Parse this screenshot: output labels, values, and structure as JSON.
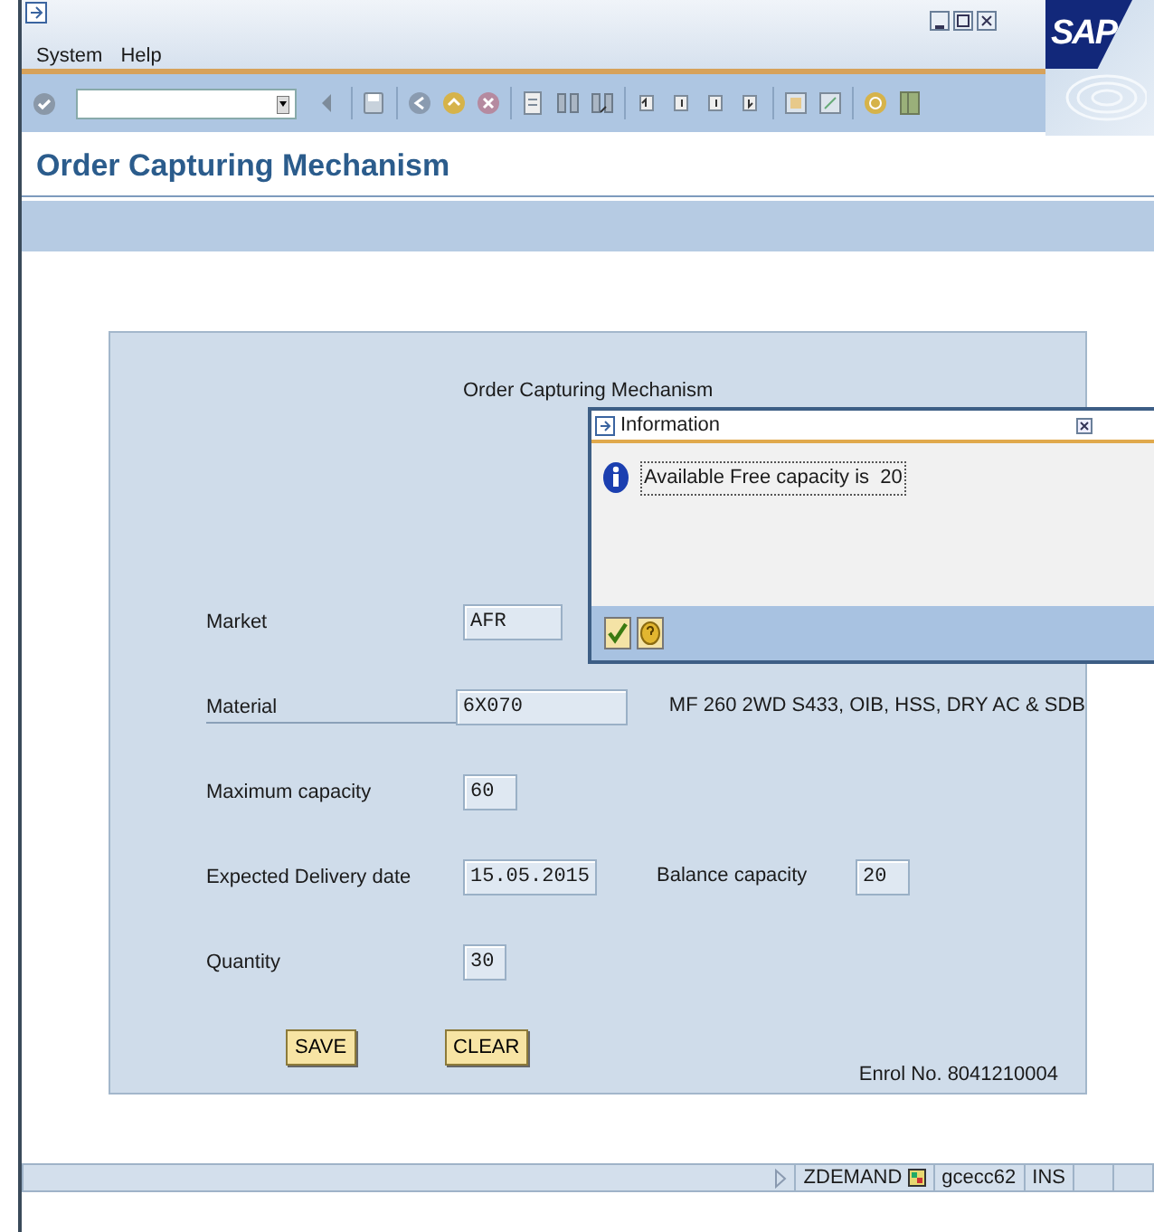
{
  "logo": "SAP",
  "menu": [
    {
      "label": "System"
    },
    {
      "label": "Help"
    }
  ],
  "page_title": "Order Capturing Mechanism",
  "form": {
    "heading": "Order Capturing Mechanism",
    "fields": [
      {
        "label": "Market",
        "value": "AFR",
        "underlined": false
      },
      {
        "label": "Material",
        "value": "6X070",
        "underlined": true
      },
      {
        "label": "Maximum capacity",
        "value": "60",
        "underlined": false
      },
      {
        "label": "Expected Delivery date",
        "value": "15.05.2015",
        "underlined": false
      },
      {
        "label": "Quantity",
        "value": "30",
        "underlined": false
      }
    ],
    "material_description": "MF 260 2WD S433, OIB, HSS, DRY AC & SDB",
    "balance": {
      "label": "Balance capacity",
      "value": "20"
    },
    "buttons": [
      "SAVE",
      "CLEAR"
    ],
    "enrol": "Enrol No. 8041210004"
  },
  "dialog": {
    "title": "Information",
    "message": "Available Free capacity is  20"
  },
  "status_bar": {
    "transaction": "ZDEMAND",
    "server": "gcecc62",
    "mode": "INS"
  }
}
